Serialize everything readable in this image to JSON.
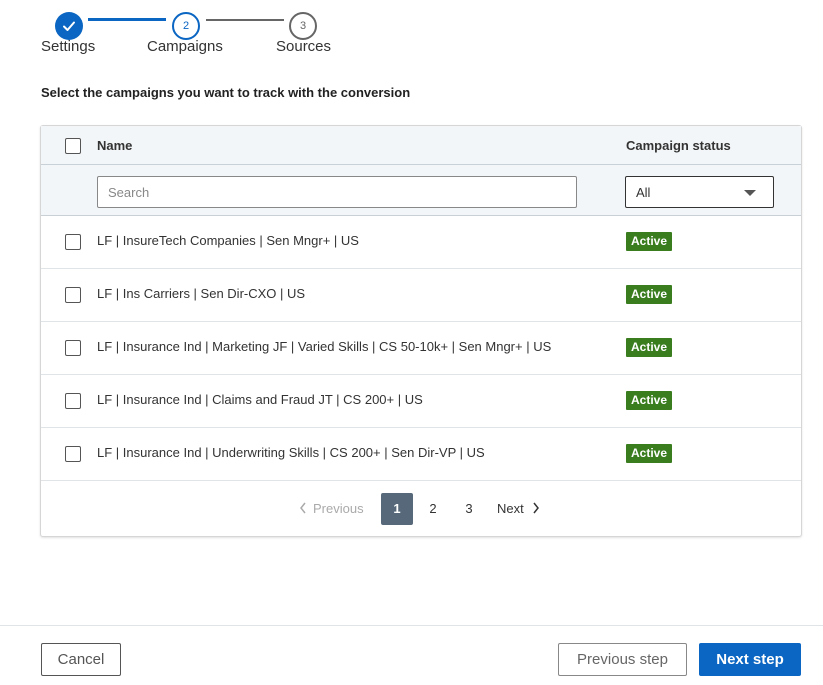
{
  "stepper": {
    "steps": [
      {
        "number": "1",
        "label": "Settings",
        "state": "completed"
      },
      {
        "number": "2",
        "label": "Campaigns",
        "state": "current"
      },
      {
        "number": "3",
        "label": "Sources",
        "state": "upcoming"
      }
    ],
    "completed_icon": "checkmark-icon"
  },
  "instruction": "Select the campaigns you want to track with the conversion",
  "table": {
    "columns": {
      "name": "Name",
      "status": "Campaign status"
    },
    "search": {
      "placeholder": "Search",
      "value": ""
    },
    "status_filter": {
      "selected": "All"
    },
    "rows": [
      {
        "name": "LF | InsureTech Companies | Sen Mngr+ | US",
        "status": "Active"
      },
      {
        "name": "LF | Ins Carriers | Sen Dir-CXO | US",
        "status": "Active"
      },
      {
        "name": "LF | Insurance Ind | Marketing JF | Varied Skills | CS 50-10k+ | Sen Mngr+ | US",
        "status": "Active"
      },
      {
        "name": "LF | Insurance Ind | Claims and Fraud JT | CS 200+ | US",
        "status": "Active"
      },
      {
        "name": "LF | Insurance Ind | Underwriting Skills | CS 200+ | Sen Dir-VP | US",
        "status": "Active"
      }
    ]
  },
  "pagination": {
    "previous": "Previous",
    "pages": [
      "1",
      "2",
      "3"
    ],
    "current": "1",
    "next": "Next"
  },
  "footer": {
    "cancel": "Cancel",
    "previous_step": "Previous step",
    "next_step": "Next step"
  },
  "colors": {
    "primary": "#0a66c2",
    "active_badge": "#3a7d1f",
    "active_page": "#56687a"
  }
}
